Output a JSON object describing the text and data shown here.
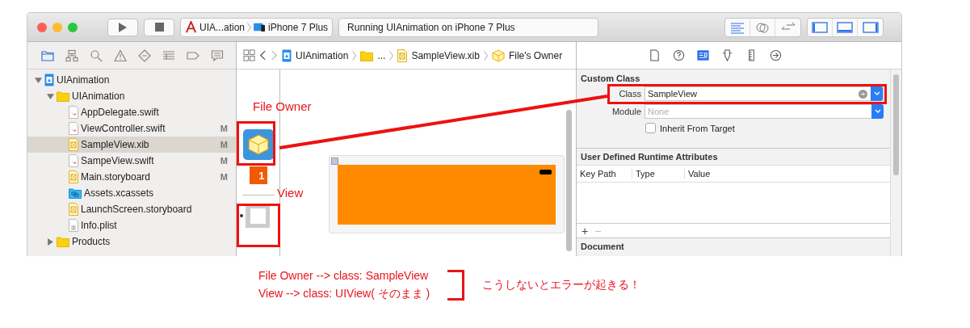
{
  "toolbar": {
    "scheme": {
      "target": "UIA...ation",
      "device": "iPhone 7 Plus"
    },
    "activity": "Running UIAnimation on iPhone 7 Plus",
    "editor_modes": [
      {
        "kind": "standard",
        "selected": true
      },
      {
        "kind": "assistant",
        "selected": false
      },
      {
        "kind": "version",
        "selected": false
      }
    ],
    "panels": [
      {
        "kind": "left",
        "on": true
      },
      {
        "kind": "bottom",
        "on": true
      },
      {
        "kind": "right",
        "on": true
      }
    ]
  },
  "navigator_tabs": [
    {
      "kind": "folder",
      "selected": true
    },
    {
      "kind": "hierarchy",
      "selected": false
    },
    {
      "kind": "search",
      "selected": false
    },
    {
      "kind": "warning",
      "selected": false
    },
    {
      "kind": "test",
      "selected": false
    },
    {
      "kind": "debug",
      "selected": false
    },
    {
      "kind": "breakpoint",
      "selected": false
    },
    {
      "kind": "report",
      "selected": false
    }
  ],
  "navigator": [
    {
      "name": "UIAnimation",
      "kind": "project",
      "expanded": true,
      "selected": false,
      "children": [
        {
          "name": "UIAnimation",
          "kind": "folder",
          "expanded": true,
          "selected": false,
          "children": [
            {
              "name": "AppDelegate.swift",
              "kind": "swift",
              "selected": false
            },
            {
              "name": "ViewController.swift",
              "kind": "swift",
              "selected": false,
              "badge": "M"
            },
            {
              "name": "SampleView.xib",
              "kind": "xib",
              "selected": true,
              "badge": "M"
            },
            {
              "name": "SampeView.swift",
              "kind": "swift",
              "selected": false,
              "badge": "M"
            },
            {
              "name": "Main.storyboard",
              "kind": "storyboard",
              "selected": false,
              "badge": "M"
            },
            {
              "name": "Assets.xcassets",
              "kind": "assets",
              "selected": false
            },
            {
              "name": "LaunchScreen.storyboard",
              "kind": "storyboard",
              "selected": false
            },
            {
              "name": "Info.plist",
              "kind": "plist",
              "selected": false
            }
          ]
        },
        {
          "name": "Products",
          "kind": "folder",
          "expanded": false,
          "selected": false
        }
      ]
    }
  ],
  "jump_bar": [
    {
      "name": "UIAnimation",
      "kind": "project"
    },
    {
      "name": "...",
      "kind": "folder"
    },
    {
      "name": "SampleView.xib",
      "kind": "xib"
    },
    {
      "name": "File's Owner",
      "kind": "object"
    }
  ],
  "outline": {
    "first_responder_badge": "1"
  },
  "inspector_tabs": [
    {
      "kind": "file",
      "selected": false
    },
    {
      "kind": "help",
      "selected": false
    },
    {
      "kind": "identity",
      "selected": true
    },
    {
      "kind": "attributes",
      "selected": false
    },
    {
      "kind": "size",
      "selected": false
    },
    {
      "kind": "connections",
      "selected": false
    }
  ],
  "custom_class": {
    "title": "Custom Class",
    "class_label": "Class",
    "class_value": "SampleView",
    "module_label": "Module",
    "module_placeholder": "None",
    "inherit": {
      "label": "Inherit From Target",
      "checked": false
    }
  },
  "runtime_attributes": {
    "title": "User Defined Runtime Attributes",
    "columns": [
      "Key Path",
      "Type",
      "Value"
    ],
    "add": "+",
    "remove": "−"
  },
  "document": {
    "title": "Document"
  },
  "annotations": {
    "file_owner_label": "File Owner",
    "view_label": "View",
    "notes": [
      "File Owner --> class: SampleView",
      "View --> class: UIView( そのまま )"
    ],
    "remark": "こうしないとエラーが起きる！"
  }
}
